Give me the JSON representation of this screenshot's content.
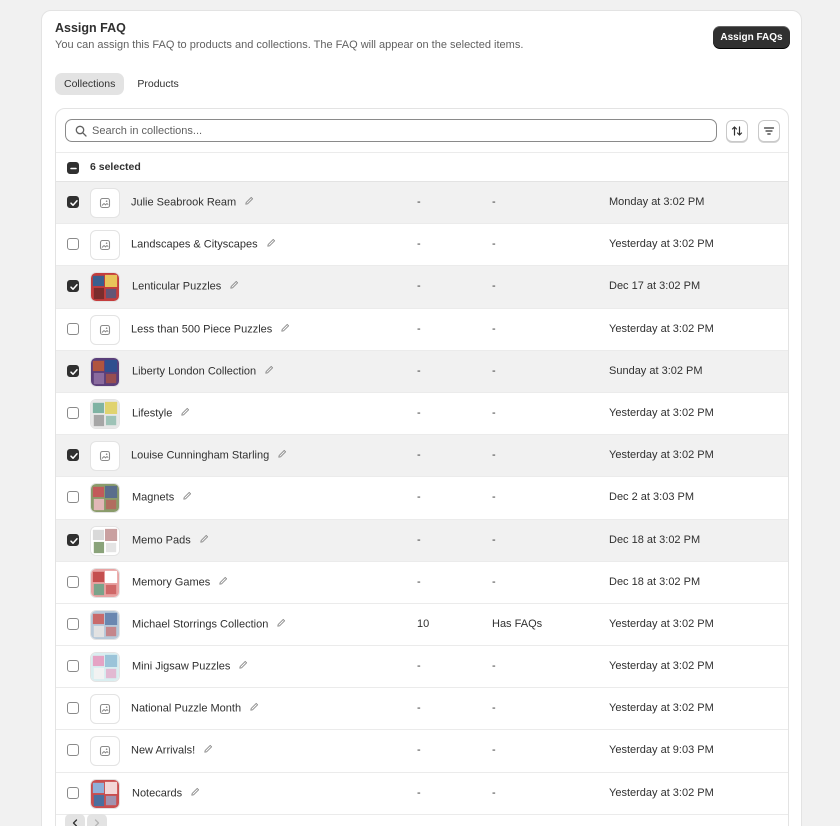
{
  "header": {
    "title": "Assign FAQ",
    "subtitle": "You can assign this FAQ to products and collections. The FAQ will appear on the selected items.",
    "assign_button": "Assign FAQs"
  },
  "tabs": [
    {
      "label": "Collections",
      "active": true
    },
    {
      "label": "Products",
      "active": false
    }
  ],
  "search": {
    "placeholder": "Search in collections..."
  },
  "selection": {
    "label": "6 selected"
  },
  "rows": [
    {
      "name": "Julie Seabrook Ream",
      "count": "-",
      "faq": "-",
      "date": "Monday at 3:02 PM",
      "checked": true,
      "thumb": "placeholder-icon"
    },
    {
      "name": "Landscapes & Cityscapes",
      "count": "-",
      "faq": "-",
      "date": "Yesterday at 3:02 PM",
      "checked": false,
      "thumb": "placeholder-icon"
    },
    {
      "name": "Lenticular Puzzles",
      "count": "-",
      "faq": "-",
      "date": "Dec 17 at 3:02 PM",
      "checked": true,
      "thumb": "image"
    },
    {
      "name": "Less than 500 Piece Puzzles",
      "count": "-",
      "faq": "-",
      "date": "Yesterday at 3:02 PM",
      "checked": false,
      "thumb": "placeholder-icon"
    },
    {
      "name": "Liberty London Collection",
      "count": "-",
      "faq": "-",
      "date": "Sunday at 3:02 PM",
      "checked": true,
      "thumb": "image"
    },
    {
      "name": "Lifestyle",
      "count": "-",
      "faq": "-",
      "date": "Yesterday at 3:02 PM",
      "checked": false,
      "thumb": "image"
    },
    {
      "name": "Louise Cunningham Starling",
      "count": "-",
      "faq": "-",
      "date": "Yesterday at 3:02 PM",
      "checked": true,
      "thumb": "placeholder-icon"
    },
    {
      "name": "Magnets",
      "count": "-",
      "faq": "-",
      "date": "Dec 2 at 3:03 PM",
      "checked": false,
      "thumb": "image"
    },
    {
      "name": "Memo Pads",
      "count": "-",
      "faq": "-",
      "date": "Dec 18 at 3:02 PM",
      "checked": true,
      "thumb": "image"
    },
    {
      "name": "Memory Games",
      "count": "-",
      "faq": "-",
      "date": "Dec 18 at 3:02 PM",
      "checked": false,
      "thumb": "image"
    },
    {
      "name": "Michael Storrings Collection",
      "count": "10",
      "faq": "Has FAQs",
      "date": "Yesterday at 3:02 PM",
      "checked": false,
      "thumb": "image"
    },
    {
      "name": "Mini Jigsaw Puzzles",
      "count": "-",
      "faq": "-",
      "date": "Yesterday at 3:02 PM",
      "checked": false,
      "thumb": "image"
    },
    {
      "name": "National Puzzle Month",
      "count": "-",
      "faq": "-",
      "date": "Yesterday at 3:02 PM",
      "checked": false,
      "thumb": "placeholder-icon"
    },
    {
      "name": "New Arrivals!",
      "count": "-",
      "faq": "-",
      "date": "Yesterday at 9:03 PM",
      "checked": false,
      "thumb": "placeholder-icon"
    },
    {
      "name": "Notecards",
      "count": "-",
      "faq": "-",
      "date": "Yesterday at 3:02 PM",
      "checked": false,
      "thumb": "image"
    }
  ],
  "pagination": {
    "prev_icon": "chevron-left-icon",
    "next_icon": "chevron-right-icon"
  },
  "colors": {
    "primary": "#303030",
    "selected_row": "#f1f1f1",
    "background": "#f1f1f1"
  }
}
